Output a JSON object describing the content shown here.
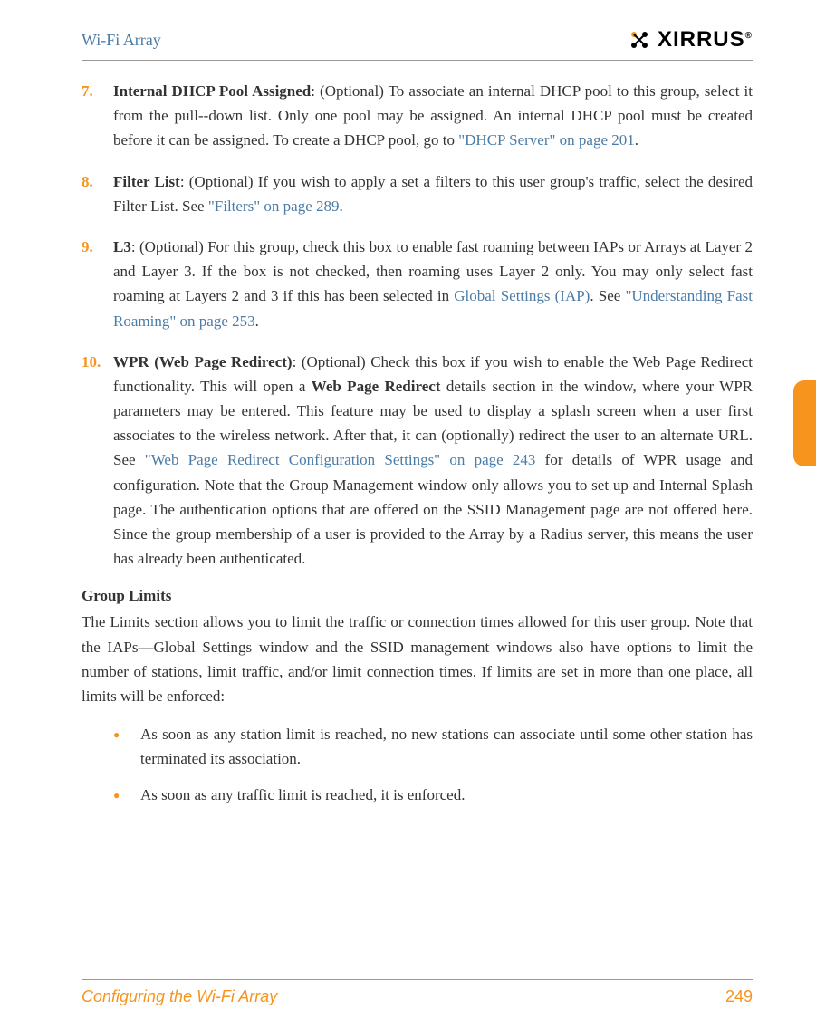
{
  "header": {
    "title": "Wi-Fi Array",
    "logo_text": "XIRRUS",
    "logo_reg": "®"
  },
  "items": [
    {
      "num": "7.",
      "label": "Internal DHCP Pool Assigned",
      "text1": ": (Optional) To associate an internal DHCP pool to this group, select it from the pull--down list. Only one pool may be assigned. An internal DHCP pool must be created before it can be assigned. To create a DHCP pool, go to ",
      "link1": "\"DHCP Server\" on page 201",
      "text2": "."
    },
    {
      "num": "8.",
      "label": "Filter List",
      "text1": ": (Optional) If you wish to apply a set a filters to this user group's traffic, select the desired Filter List. See ",
      "link1": "\"Filters\" on page 289",
      "text2": "."
    },
    {
      "num": "9.",
      "label": "L3",
      "text1": ": (Optional) For this group, check this box to enable fast roaming between IAPs or Arrays at Layer 2 and Layer 3. If the box is not checked, then roaming uses Layer 2 only. You may only select fast roaming at Layers 2 and 3 if this has been selected in ",
      "link1": "Global Settings (IAP)",
      "text2": ". See ",
      "link2": "\"Understanding Fast Roaming\" on page 253",
      "text3": "."
    },
    {
      "num": "10.",
      "label": "WPR (Web Page Redirect)",
      "text1": ": (Optional) Check this box if you wish to enable the Web Page Redirect functionality. This will open a ",
      "bold1": "Web Page Redirect",
      "text2": " details section in the window, where your WPR parameters may be entered. This feature may be used to display a splash screen when a user first associates to the wireless network. After that, it can (optionally) redirect the user to an alternate URL. See ",
      "link1": "\"Web Page Redirect Configuration Settings\" on page 243",
      "text3": " for details of WPR usage and configuration. Note that the Group Management window only allows you to set up and Internal Splash page. The authentication options that are offered on the SSID Management page are not offered here. Since the group membership of a user is provided to the Array by a Radius server, this means the user has already been authenticated."
    }
  ],
  "section": {
    "heading": "Group Limits",
    "para": "The Limits section allows you to limit the traffic or connection times allowed for this user group. Note that the IAPs—Global Settings window and the SSID management windows also have options to limit the number of stations, limit traffic, and/or limit connection times. If limits are set in more than one place, all limits will be enforced:"
  },
  "bullets": [
    {
      "text": "As soon as any station limit is reached, no new stations can associate until some other station has terminated its association."
    },
    {
      "text": "As soon as any traffic limit is reached, it is enforced."
    }
  ],
  "footer": {
    "text": "Configuring the Wi-Fi Array",
    "page": "249"
  }
}
